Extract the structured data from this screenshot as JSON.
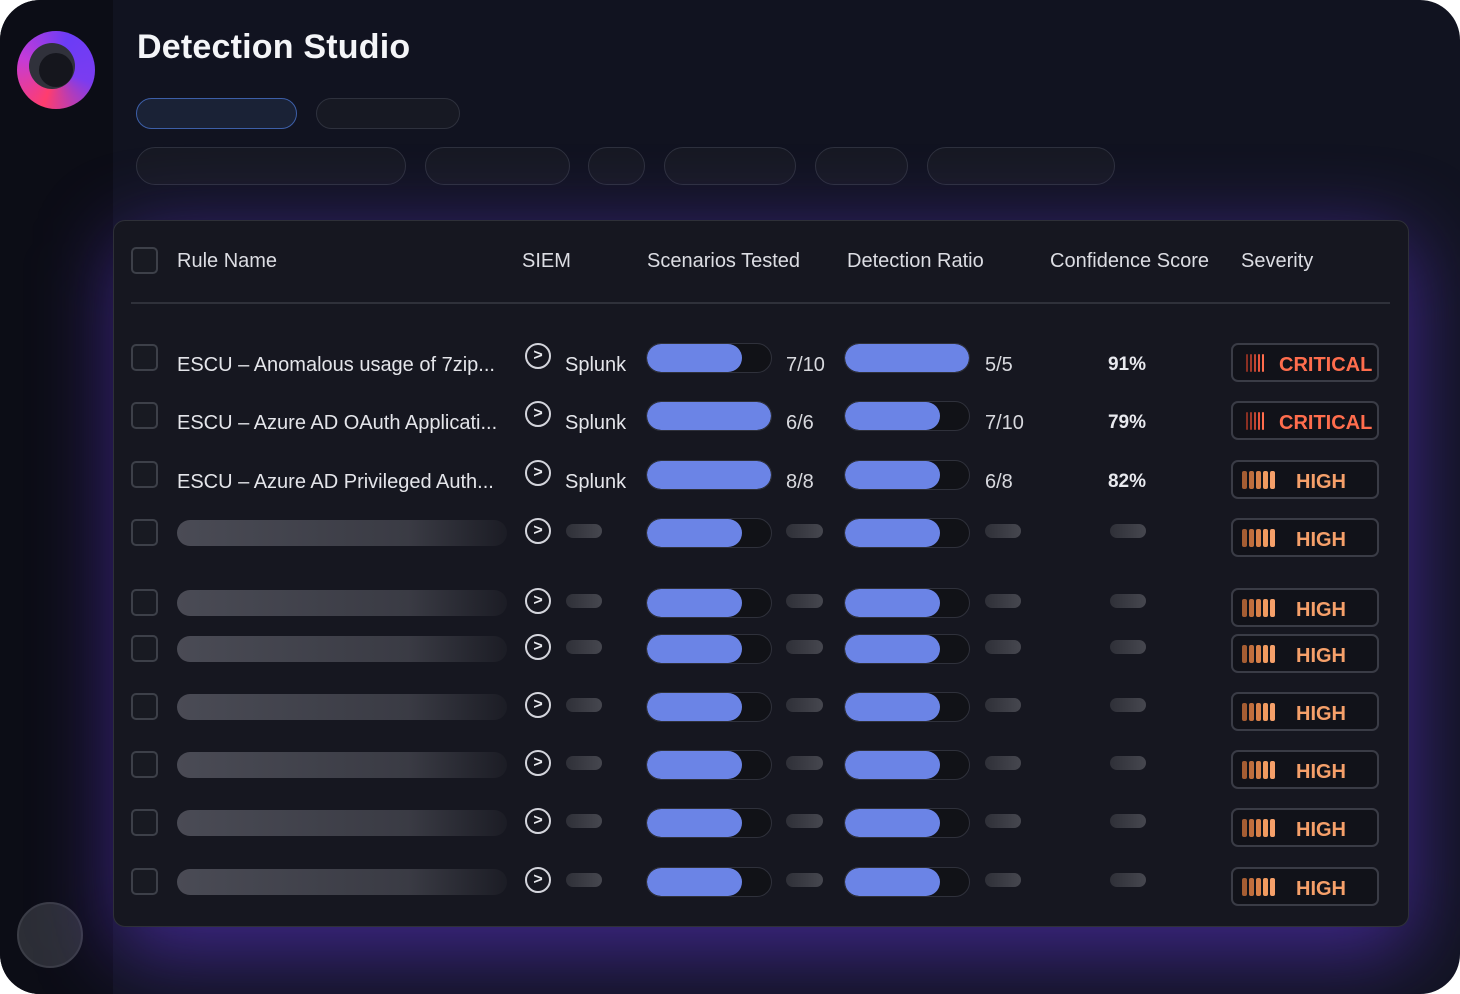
{
  "app": {
    "title": "Detection Studio"
  },
  "table": {
    "columns": {
      "rule_name": "Rule Name",
      "siem": "SIEM",
      "scenarios_tested": "Scenarios Tested",
      "detection_ratio": "Detection Ratio",
      "confidence_score": "Confidence Score",
      "severity": "Severity"
    },
    "rows": [
      {
        "rule_name": "ESCU – Anomalous usage of 7zip...",
        "siem": "Splunk",
        "scenarios_tested": "7/10",
        "scenarios_fill": 0.77,
        "detection_ratio": "5/5",
        "detection_fill": 1.0,
        "confidence": "91%",
        "severity": "CRITICAL"
      },
      {
        "rule_name": "ESCU – Azure AD OAuth Applicati...",
        "siem": "Splunk",
        "scenarios_tested": "6/6",
        "scenarios_fill": 1.0,
        "detection_ratio": "7/10",
        "detection_fill": 0.77,
        "confidence": "79%",
        "severity": "CRITICAL"
      },
      {
        "rule_name": "ESCU – Azure AD Privileged Auth...",
        "siem": "Splunk",
        "scenarios_tested": "8/8",
        "scenarios_fill": 1.0,
        "detection_ratio": "6/8",
        "detection_fill": 0.77,
        "confidence": "82%",
        "severity": "HIGH"
      },
      {
        "placeholder": true,
        "scenarios_fill": 0.77,
        "detection_fill": 0.77,
        "severity": "HIGH"
      },
      {
        "placeholder": true,
        "scenarios_fill": 0.77,
        "detection_fill": 0.77,
        "severity": "HIGH"
      },
      {
        "placeholder": true,
        "scenarios_fill": 0.77,
        "detection_fill": 0.77,
        "severity": "HIGH"
      },
      {
        "placeholder": true,
        "scenarios_fill": 0.77,
        "detection_fill": 0.77,
        "severity": "HIGH"
      },
      {
        "placeholder": true,
        "scenarios_fill": 0.77,
        "detection_fill": 0.77,
        "severity": "HIGH"
      },
      {
        "placeholder": true,
        "scenarios_fill": 0.77,
        "detection_fill": 0.77,
        "severity": "HIGH"
      },
      {
        "placeholder": true,
        "scenarios_fill": 0.77,
        "detection_fill": 0.77,
        "severity": "HIGH"
      }
    ]
  },
  "icons": {
    "logo": "app-logo-icon",
    "row_action": "chevron-right-icon",
    "severity_critical": "critical-bars-icon",
    "severity_high": "high-bars-icon"
  },
  "colors": {
    "accent_bar": "#6b84e6",
    "critical": "#ff6d4d",
    "high": "#f6a06a",
    "background": "#111320"
  }
}
